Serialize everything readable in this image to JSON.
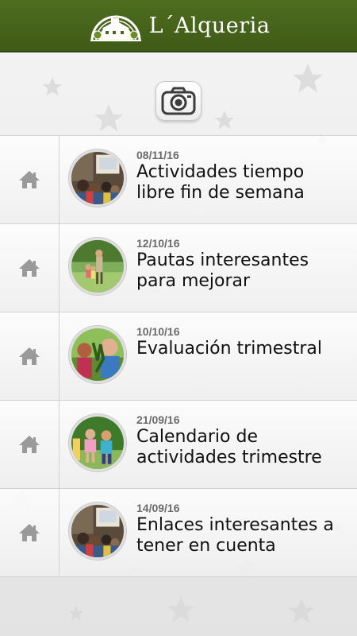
{
  "app": {
    "title": "L´Alqueria",
    "colors": {
      "header": "#4a671c",
      "background": "#ececec",
      "date_text": "#6b6b6b",
      "title_text": "#111111"
    }
  },
  "toolbar": {
    "camera_icon": "camera-icon"
  },
  "posts": [
    {
      "date": "08/11/16",
      "title": "Actividades tiempo libre fin de semana",
      "home_icon": "home-icon"
    },
    {
      "date": "12/10/16",
      "title": "Pautas interesantes para mejorar",
      "home_icon": "home-icon"
    },
    {
      "date": "10/10/16",
      "title": "Evaluación trimestral",
      "home_icon": "home-icon"
    },
    {
      "date": "21/09/16",
      "title": "Calendario de actividades trimestre",
      "home_icon": "home-icon"
    },
    {
      "date": "14/09/16",
      "title": "Enlaces interesantes a tener en cuenta",
      "home_icon": "home-icon"
    }
  ]
}
